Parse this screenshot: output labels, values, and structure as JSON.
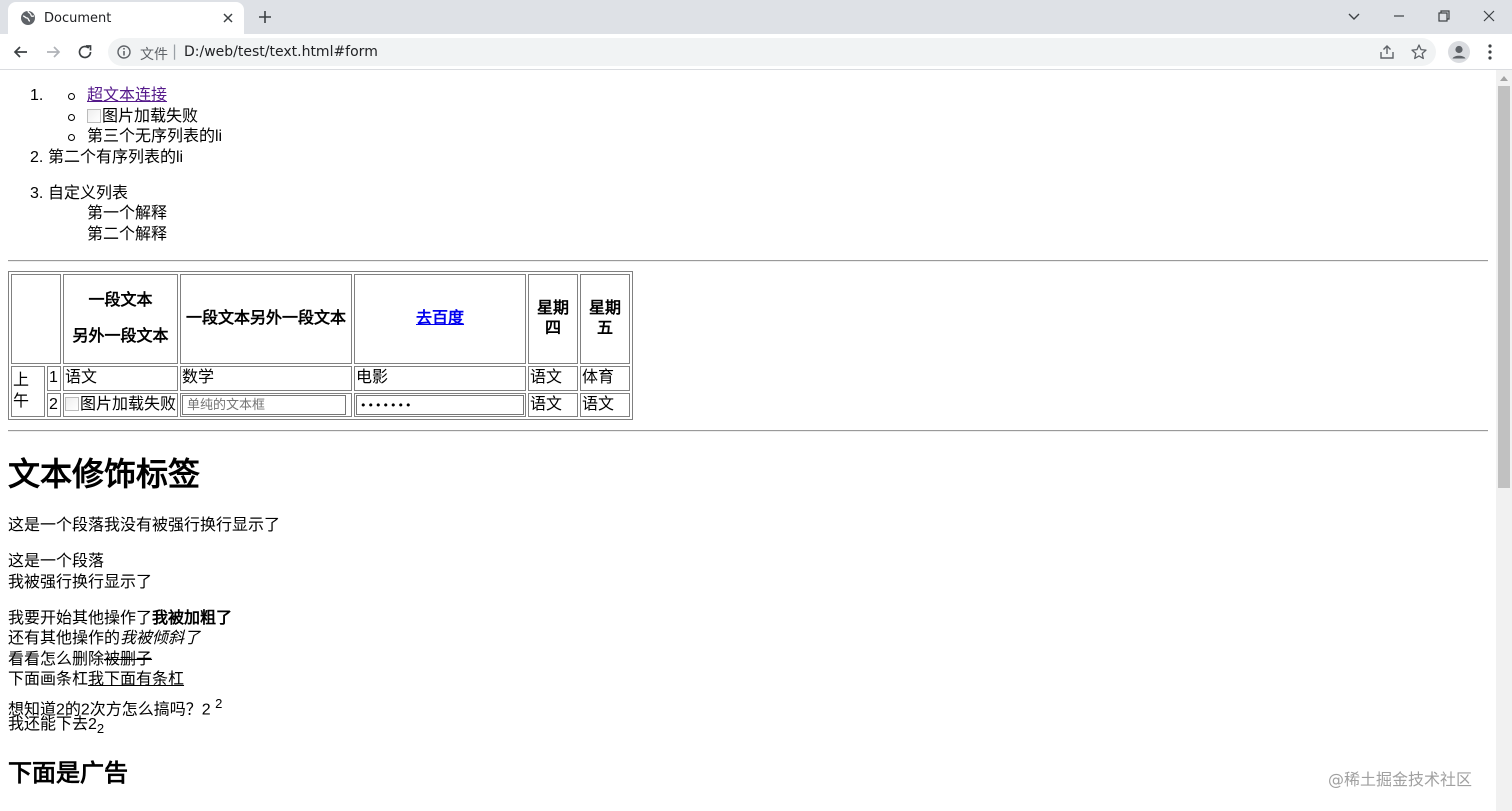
{
  "browser": {
    "tab_title": "Document",
    "address_scheme": "文件",
    "address_sep": "|",
    "address_url": "D:/web/test/text.html#form"
  },
  "lists": {
    "ol_markers": [
      "1.",
      "2.",
      "3."
    ],
    "ul_items": {
      "link": "超文本连接",
      "img_alt": "图片加载失败",
      "third": "第三个无序列表的li"
    },
    "ol_item2": "第二个有序列表的li",
    "dl_term": "自定义列表",
    "dl_defs": [
      "第一个解释",
      "第二个解释"
    ]
  },
  "table": {
    "head": {
      "col2_line1": "一段文本",
      "col2_line2": "另外一段文本",
      "col3": "一段文本另外一段文本",
      "col4_link": "去百度",
      "col5": "星期四",
      "col6": "星期五"
    },
    "row_group": "上午",
    "row1": {
      "num": "1",
      "c2": "语文",
      "c3": "数学",
      "c4": "电影",
      "c5": "语文",
      "c6": "体育"
    },
    "row2": {
      "num": "2",
      "img_alt": "图片加载失败",
      "text_placeholder": "单纯的文本框",
      "password_value": "•••••••",
      "c5": "语文",
      "c6": "语文"
    }
  },
  "content": {
    "h1": "文本修饰标签",
    "p1": "这是一个段落我没有被强行换行显示了",
    "p2_line1": "这是一个段落",
    "p2_line2": "我被强行换行显示了",
    "bold_prefix": "我要开始其他操作了",
    "bold_text": "我被加粗了",
    "italic_prefix": "还有其他操作的",
    "italic_text": "我被倾斜了",
    "strike_prefix": "看看怎么删除",
    "strike_text": "被删子",
    "underline_prefix": "下面画条杠",
    "underline_text": "我下面有条杠",
    "sup_prefix": "想知道2的2次方怎么搞吗？2",
    "sup_text": "2",
    "sub_prefix": "我还能下去2",
    "sub_text": "2",
    "h2": "下面是广告"
  },
  "watermark": "@稀土掘金技术社区"
}
